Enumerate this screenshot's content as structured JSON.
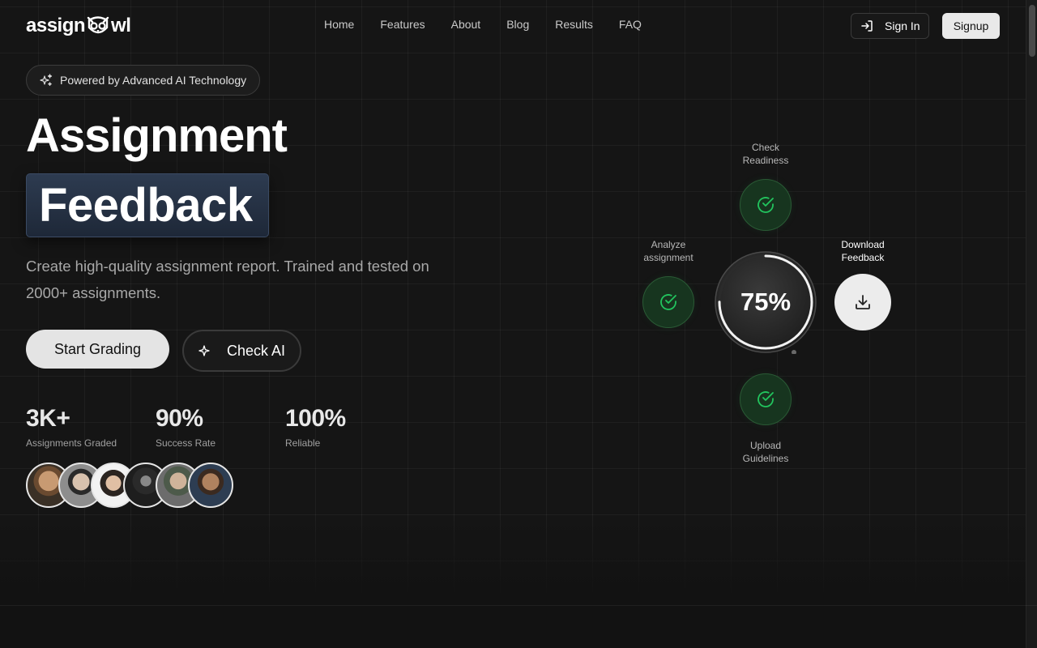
{
  "brand": {
    "name_left": "assign",
    "name_right": "wl"
  },
  "nav": {
    "items": [
      "Home",
      "Features",
      "About",
      "Blog",
      "Results",
      "FAQ"
    ]
  },
  "auth": {
    "signin": "Sign In",
    "signup": "Signup"
  },
  "hero": {
    "badge": "Powered by Advanced AI Technology",
    "title_line1": "Assignment",
    "title_line2": "Feedback",
    "subtitle": "Create high-quality assignment report. Trained and tested on 2000+ assignments.",
    "primary_button": "Start Grading",
    "secondary_button": "Check AI"
  },
  "stats": [
    {
      "value": "3K+",
      "label": "Assignments Graded"
    },
    {
      "value": "90%",
      "label": "Success Rate"
    },
    {
      "value": "100%",
      "label": "Reliable"
    }
  ],
  "avatars_count": 6,
  "workflow": {
    "progress_label": "75%",
    "progress_fraction": 0.75,
    "steps": {
      "check_readiness": [
        "Check",
        "Readiness"
      ],
      "analyze": [
        "Analyze",
        "assignment"
      ],
      "download": [
        "Download",
        "Feedback"
      ],
      "upload": [
        "Upload",
        "Guidelines"
      ]
    }
  },
  "colors": {
    "accent_green": "#22c55e",
    "node_bg": "#17351f",
    "title_box": "#2a374a"
  }
}
